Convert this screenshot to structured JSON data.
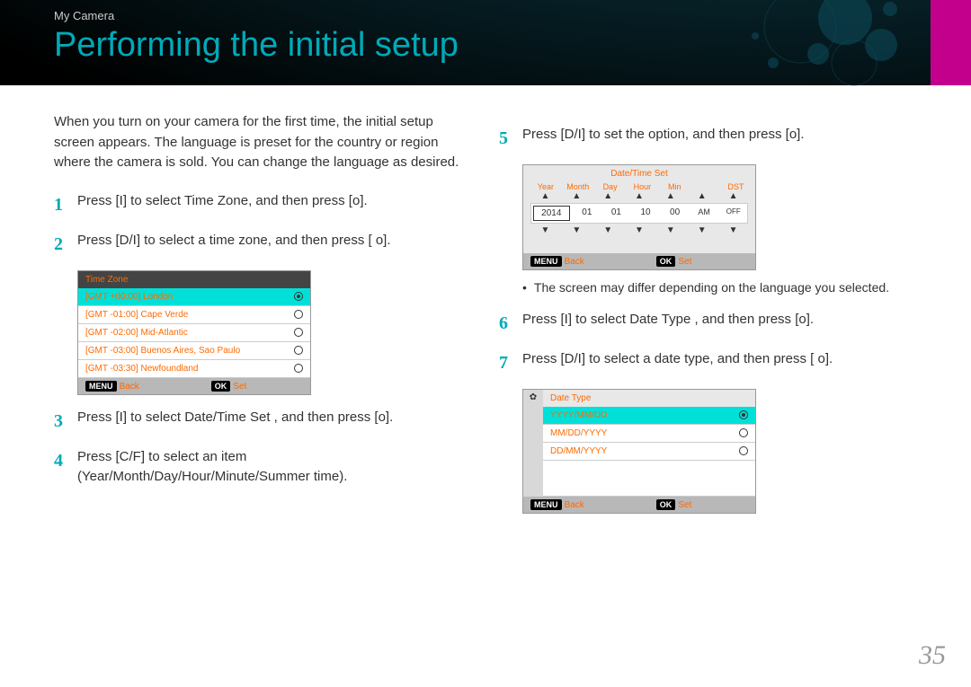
{
  "header": {
    "breadcrumb": "My Camera",
    "title": "Performing the initial setup"
  },
  "intro": "When you turn on your camera for the first time, the initial setup screen appears. The language is preset for the country or region where the camera is sold. You can change the language as desired.",
  "steps": {
    "s1": {
      "num": "1",
      "text": "Press [I] to select Time Zone, and then press [o]."
    },
    "s2": {
      "num": "2",
      "text": "Press [D/I] to select a time zone, and then press [      o]."
    },
    "s3": {
      "num": "3",
      "text": "Press [I] to select Date/Time Set    , and then press [o]."
    },
    "s4": {
      "num": "4",
      "text": "Press [C/F] to select an item (Year/Month/Day/Hour/Minute/Summer time)."
    },
    "s5": {
      "num": "5",
      "text": "Press [D/I] to set the option, and then press [o]."
    },
    "s6": {
      "num": "6",
      "text": "Press [I] to select Date Type    , and then press [o]."
    },
    "s7": {
      "num": "7",
      "text": "Press [D/I] to select a date type, and then press [      o]."
    }
  },
  "timezone_screen": {
    "title": "Time Zone",
    "rows": [
      {
        "label": "[GMT +00:00] London",
        "selected": true
      },
      {
        "label": "[GMT -01:00] Cape Verde",
        "selected": false
      },
      {
        "label": "[GMT -02:00] Mid-Atlantic",
        "selected": false
      },
      {
        "label": "[GMT -03:00] Buenos Aires, Sao Paulo",
        "selected": false
      },
      {
        "label": "[GMT -03:30] Newfoundland",
        "selected": false
      }
    ],
    "footer": {
      "menu": "MENU",
      "back": "Back",
      "ok": "OK",
      "set": "Set"
    }
  },
  "datetime_screen": {
    "title": "Date/Time Set",
    "labels": [
      "Year",
      "Month",
      "Day",
      "Hour",
      "Min",
      "",
      "DST"
    ],
    "values": {
      "year": "2014",
      "month": "01",
      "day": "01",
      "hour": "10",
      "min": "00",
      "ampm": "AM",
      "dst": "OFF"
    },
    "footer": {
      "menu": "MENU",
      "back": "Back",
      "ok": "OK",
      "set": "Set"
    }
  },
  "note": "The screen may differ depending on the language you selected.",
  "datetype_screen": {
    "title": "Date Type",
    "rows": [
      {
        "label": "YYYY/MM/DD",
        "selected": true
      },
      {
        "label": "MM/DD/YYYY",
        "selected": false
      },
      {
        "label": "DD/MM/YYYY",
        "selected": false
      }
    ],
    "footer": {
      "menu": "MENU",
      "back": "Back",
      "ok": "OK",
      "set": "Set"
    }
  },
  "page_number": "35"
}
